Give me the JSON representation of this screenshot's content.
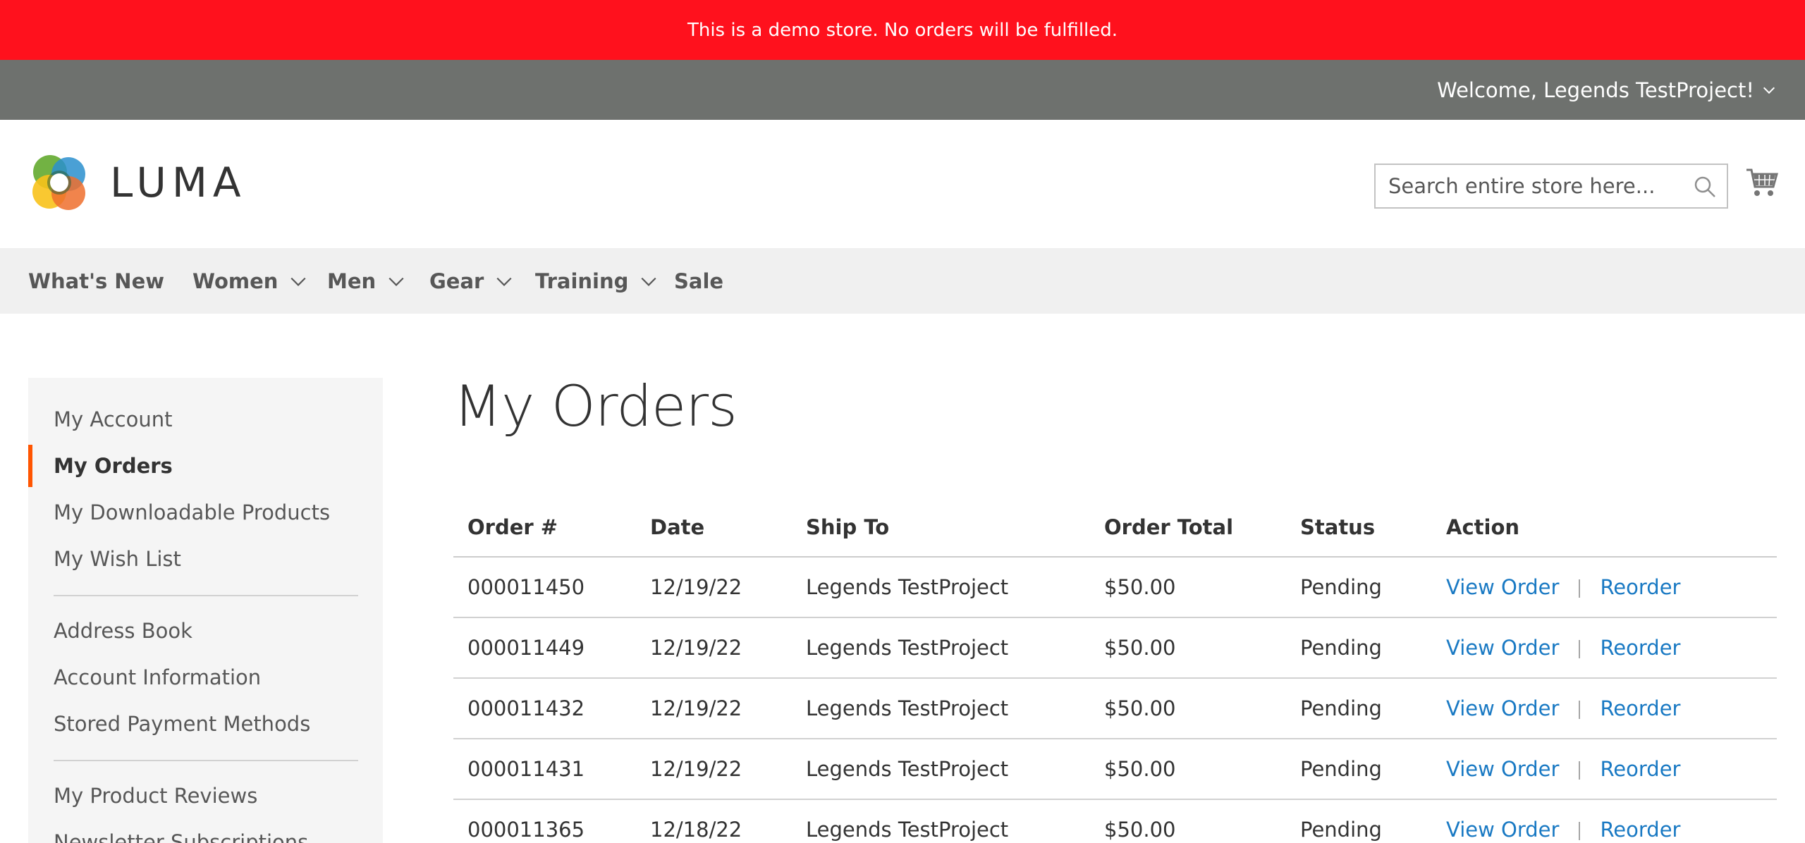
{
  "banner": {
    "text": "This is a demo store. No orders will be fulfilled."
  },
  "topbar": {
    "welcome": "Welcome, Legends TestProject!"
  },
  "header": {
    "logo_text": "LUMA",
    "search_placeholder": "Search entire store here..."
  },
  "nav": {
    "items": [
      {
        "label": "What's New"
      },
      {
        "label": "Women"
      },
      {
        "label": "Men"
      },
      {
        "label": "Gear"
      },
      {
        "label": "Training"
      },
      {
        "label": "Sale"
      }
    ]
  },
  "sidebar": {
    "items": [
      {
        "label": "My Account"
      },
      {
        "label": "My Orders"
      },
      {
        "label": "My Downloadable Products"
      },
      {
        "label": "My Wish List"
      },
      {
        "label": "Address Book"
      },
      {
        "label": "Account Information"
      },
      {
        "label": "Stored Payment Methods"
      },
      {
        "label": "My Product Reviews"
      },
      {
        "label": "Newsletter Subscriptions"
      }
    ]
  },
  "page": {
    "title": "My Orders"
  },
  "table": {
    "headers": [
      "Order #",
      "Date",
      "Ship To",
      "Order Total",
      "Status",
      "Action"
    ],
    "action_view": "View Order",
    "action_reorder": "Reorder",
    "rows": [
      {
        "order": "000011450",
        "date": "12/19/22",
        "ship_to": "Legends TestProject",
        "total": "$50.00",
        "status": "Pending"
      },
      {
        "order": "000011449",
        "date": "12/19/22",
        "ship_to": "Legends TestProject",
        "total": "$50.00",
        "status": "Pending"
      },
      {
        "order": "000011432",
        "date": "12/19/22",
        "ship_to": "Legends TestProject",
        "total": "$50.00",
        "status": "Pending"
      },
      {
        "order": "000011431",
        "date": "12/19/22",
        "ship_to": "Legends TestProject",
        "total": "$50.00",
        "status": "Pending"
      },
      {
        "order": "000011365",
        "date": "12/18/22",
        "ship_to": "Legends TestProject",
        "total": "$50.00",
        "status": "Pending"
      }
    ]
  },
  "colors": {
    "banner": "#ff111d",
    "topbar": "#6e716e",
    "nav_bg": "#f0f0f0",
    "sidebar_bg": "#f5f5f5",
    "active_accent": "#ff5501",
    "link": "#1979c3"
  },
  "icons": {
    "welcome_dropdown": "chevron-down-icon",
    "search": "search-icon",
    "cart": "cart-icon",
    "nav_dropdown": "chevron-down-icon"
  }
}
